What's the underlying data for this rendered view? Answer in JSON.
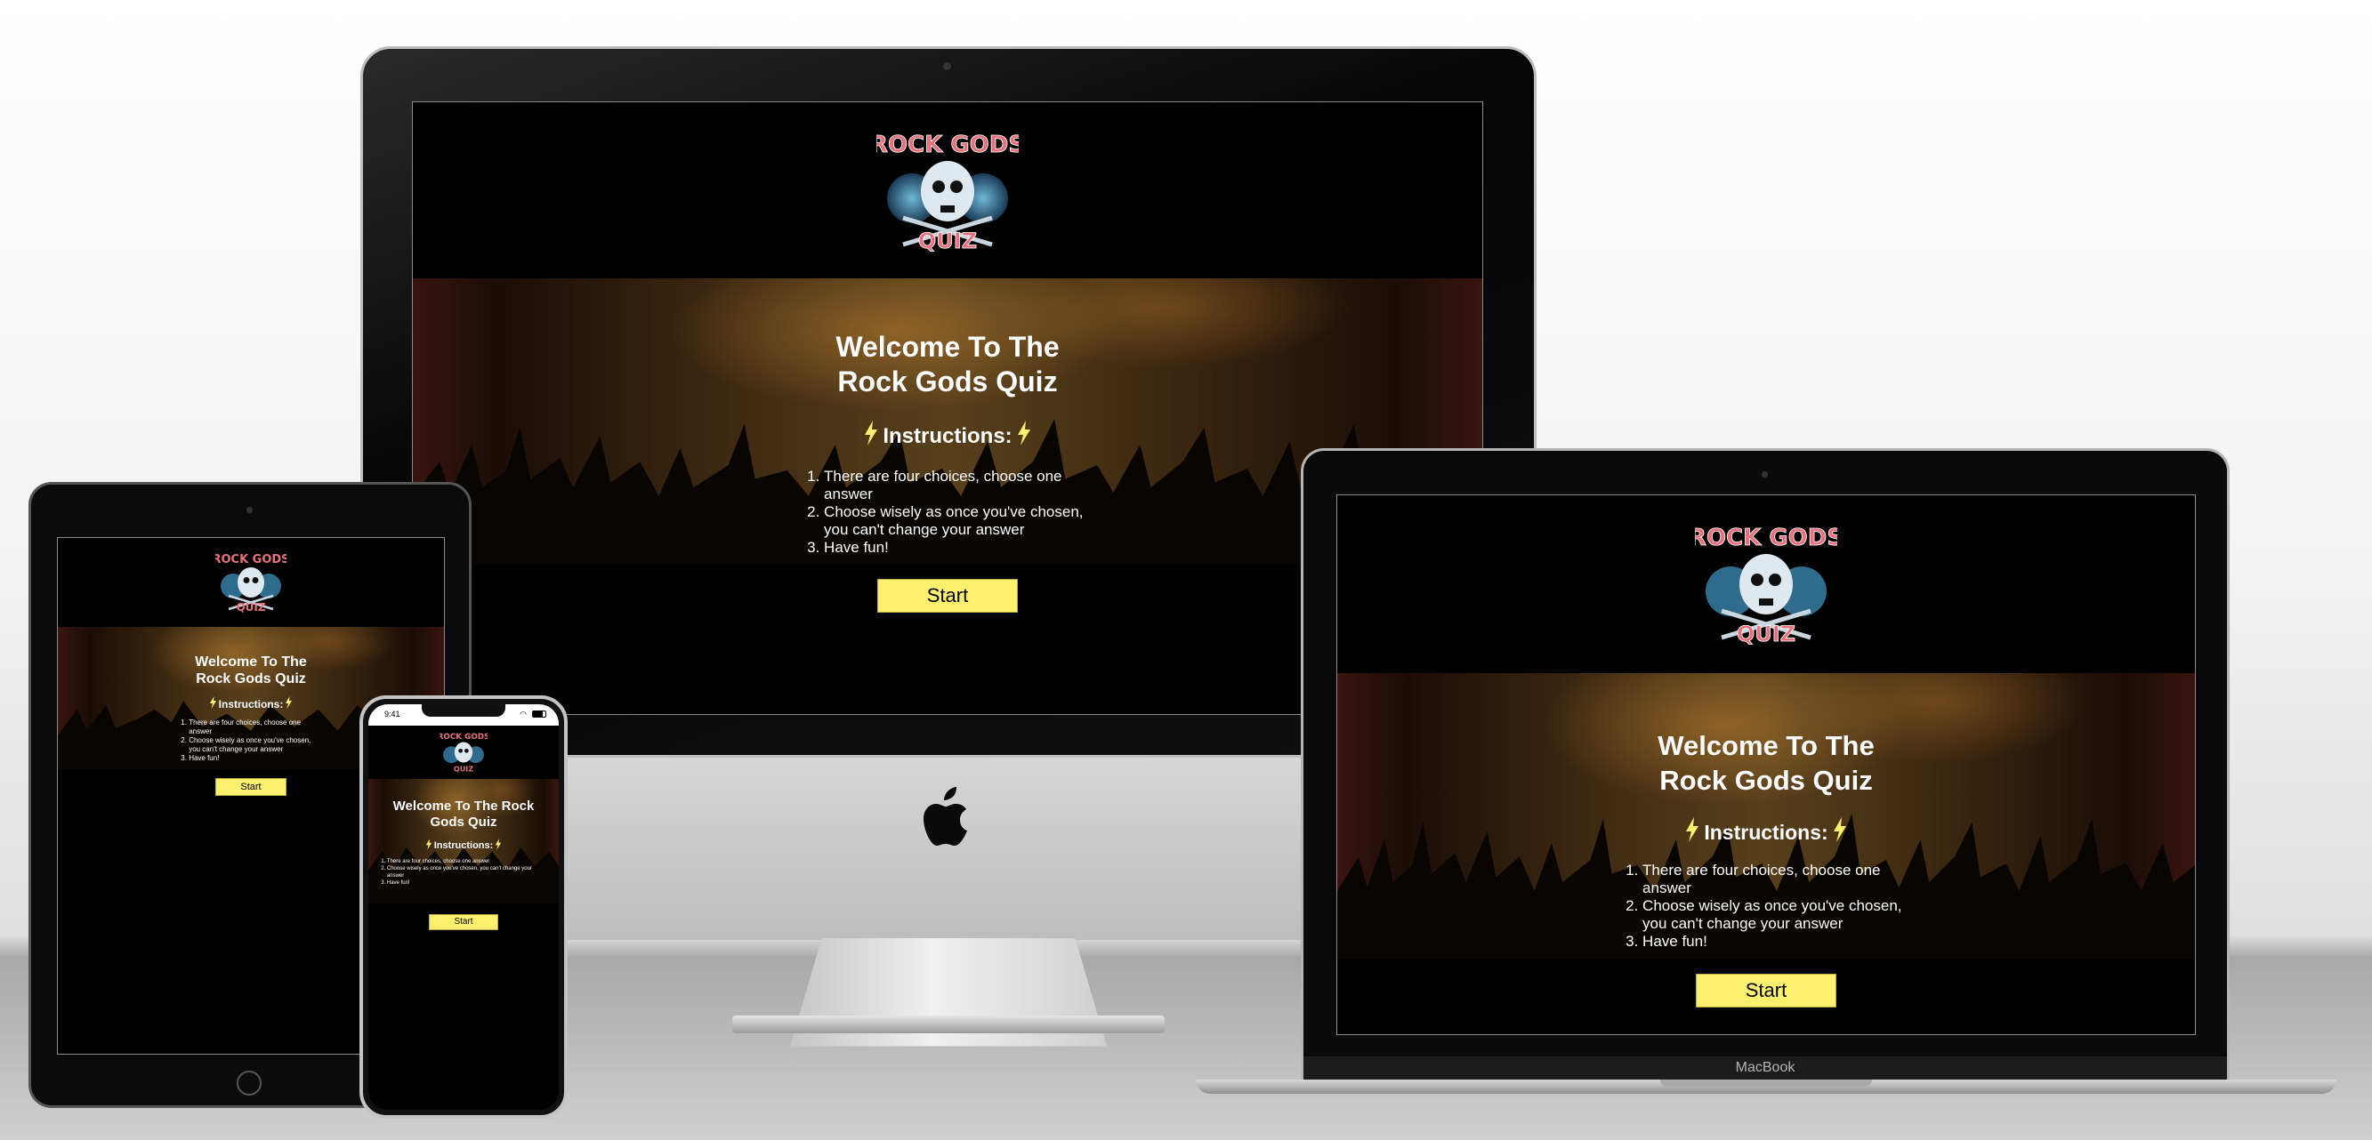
{
  "site": {
    "logo": {
      "line1": "ROCK GODS",
      "line2": "QUIZ"
    },
    "title": "Welcome To The Rock Gods Quiz",
    "instructions_heading": "Instructions:",
    "instructions": [
      "There are four choices, choose one answer",
      "Choose wisely as once you've chosen, you can't change your answer",
      "Have fun!"
    ],
    "start_label": "Start"
  },
  "devices": {
    "laptop_brand": "MacBook",
    "phone_time": "9:41"
  },
  "colors": {
    "accent": "#fdf06f",
    "background": "#000000",
    "text": "#ffffff",
    "logo_text": "#e8707a"
  }
}
